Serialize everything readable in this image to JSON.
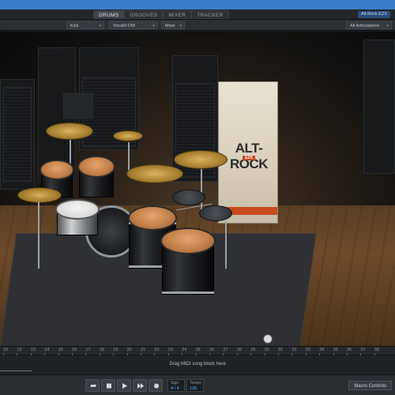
{
  "header": {
    "tabs": [
      {
        "label": "DRUMS",
        "active": true
      },
      {
        "label": "GROOVES",
        "active": false
      },
      {
        "label": "MIXER",
        "active": false
      },
      {
        "label": "TRACKER",
        "active": false
      }
    ],
    "brand_badge": "Alt-Rock EZX"
  },
  "preset_bar": {
    "kit": "Kick",
    "preset": "Vocal® DW Collector's",
    "more": "More",
    "articulations": "All Articulations"
  },
  "stage": {
    "banner_title": "ALT-ROCK",
    "banner_sub": "EZX"
  },
  "ruler": {
    "bars": [
      "10",
      "12",
      "13",
      "14",
      "15",
      "16",
      "17",
      "18",
      "19",
      "20",
      "21",
      "22",
      "23",
      "24",
      "25",
      "26",
      "27",
      "28",
      "29",
      "30",
      "31",
      "32",
      "33",
      "34",
      "35",
      "36",
      "37",
      "38"
    ]
  },
  "track": {
    "drop_hint": "Drag MIDI song block here"
  },
  "transport": {
    "sign_label": "Sign.",
    "sign_value": "4 / 4",
    "tempo_label": "Tempo",
    "tempo_value": "120",
    "macro_label": "Macro Controls"
  },
  "colors": {
    "accent": "#3a7dc8",
    "banner_orange": "#c84a1f",
    "readout_blue": "#65b4ff"
  },
  "icons": {
    "loop": "loop-icon",
    "stop": "stop-icon",
    "play": "play-icon",
    "forward": "forward-icon",
    "record": "record-icon"
  }
}
